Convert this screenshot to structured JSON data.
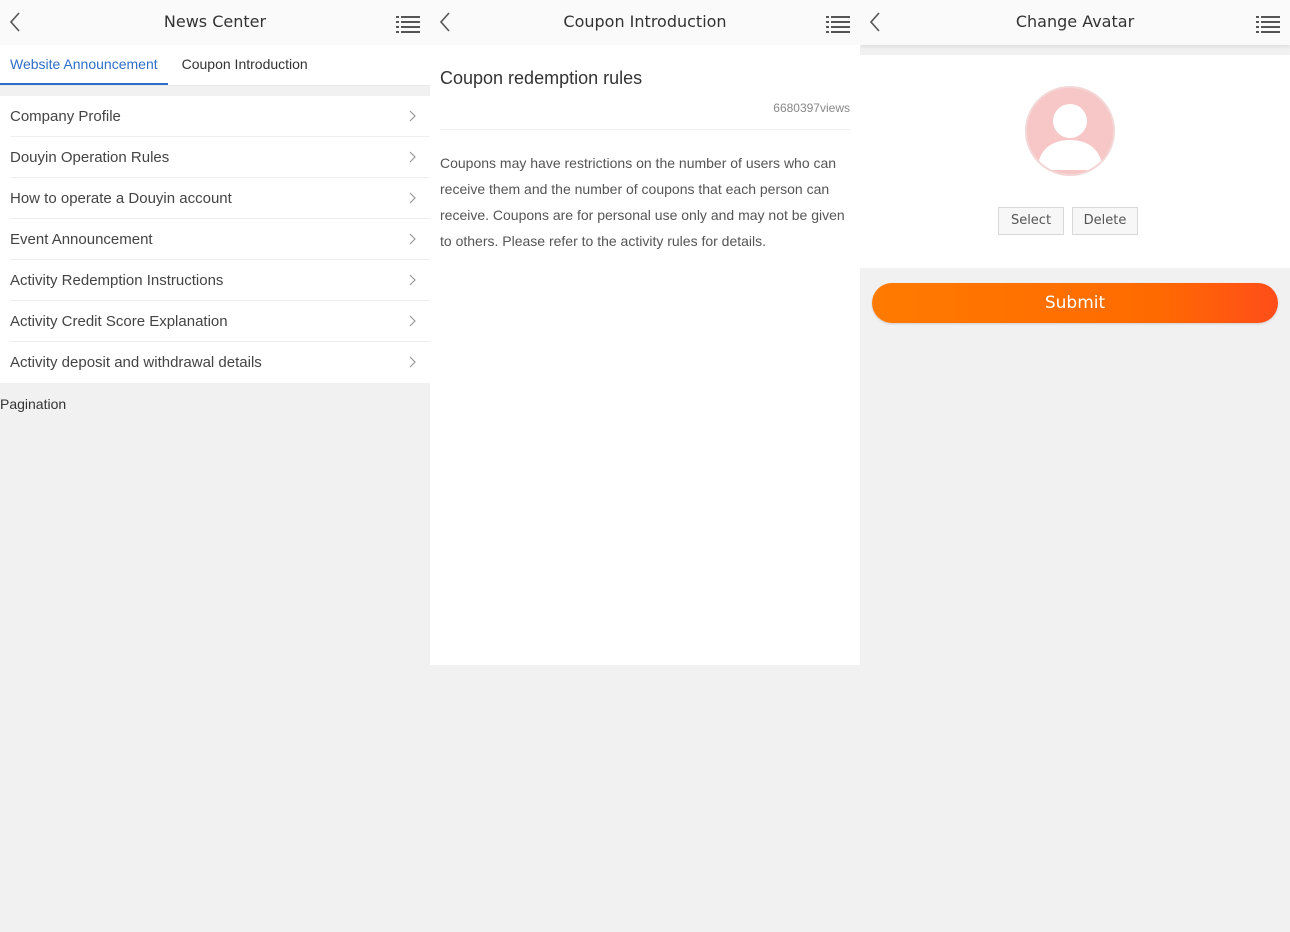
{
  "screen1": {
    "title": "News Center",
    "tabs": [
      {
        "label": "Website Announcement",
        "active": true
      },
      {
        "label": "Coupon Introduction",
        "active": false
      }
    ],
    "items": [
      {
        "label": "Company Profile"
      },
      {
        "label": "Douyin Operation Rules"
      },
      {
        "label": "How to operate a Douyin account"
      },
      {
        "label": "Event Announcement"
      },
      {
        "label": "Activity Redemption Instructions"
      },
      {
        "label": "Activity Credit Score Explanation"
      },
      {
        "label": "Activity deposit and withdrawal details"
      }
    ],
    "pagination": "Pagination"
  },
  "screen2": {
    "title": "Coupon Introduction",
    "article_title": "Coupon redemption rules",
    "views": "6680397views",
    "body": "Coupons may have restrictions on the number of users who can receive them and the number of coupons that each person can receive. Coupons are for personal use only and may not be given to others. Please refer to the activity rules for details."
  },
  "screen3": {
    "title": "Change Avatar",
    "select_label": "Select",
    "delete_label": "Delete",
    "submit_label": "Submit"
  },
  "icons": {
    "back": "chevron-left-icon",
    "menu": "list-menu-icon",
    "chevron": "chevron-right-icon",
    "avatar": "user-placeholder-icon"
  },
  "colors": {
    "accent": "#2f6fc7",
    "submit_start": "#ff7a00",
    "submit_end": "#ff4d1a",
    "avatar_pink": "#f9c9c9",
    "background": "#f1f1f2"
  }
}
